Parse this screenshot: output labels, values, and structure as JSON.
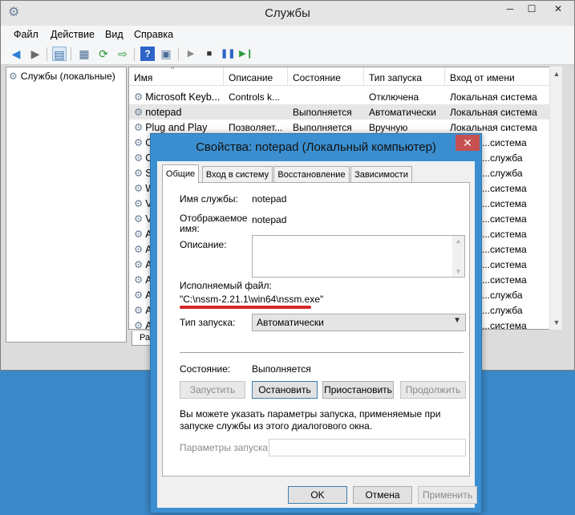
{
  "window": {
    "title": "Службы",
    "controls": {
      "minimize": "─",
      "maximize": "☐",
      "close": "✕"
    }
  },
  "menu": [
    "Файл",
    "Действие",
    "Вид",
    "Справка"
  ],
  "toolbar_icons": [
    "back-arrow-icon",
    "forward-arrow-icon",
    "console-tree-icon",
    "properties-icon",
    "refresh-icon",
    "export-icon",
    "help-icon",
    "view-icon",
    "play-icon",
    "stop-icon",
    "pause-icon",
    "restart-icon"
  ],
  "tree": {
    "root_label": "Службы (локальные)"
  },
  "list": {
    "columns": [
      "Имя",
      "Описание",
      "Состояние",
      "Тип запуска",
      "Вход от имени"
    ],
    "rows": [
      {
        "name": "Microsoft Keyb...",
        "description": "Controls k...",
        "state": "",
        "startup": "Отключена",
        "logon": "Локальная система"
      },
      {
        "name": "notepad",
        "description": "",
        "state": "Выполняется",
        "startup": "Автоматически",
        "logon": "Локальная система"
      },
      {
        "name": "Plug and Play",
        "description": "Позволяет...",
        "state": "Выполняется",
        "startup": "Вручную",
        "logon": "Локальная система"
      },
      {
        "name": "О",
        "logon": "...система"
      },
      {
        "name": "С",
        "logon": "...служба"
      },
      {
        "name": "S",
        "logon": "...служба"
      },
      {
        "name": "W",
        "logon": "...система"
      },
      {
        "name": "V",
        "logon": "...система"
      },
      {
        "name": "V",
        "logon": "...система"
      },
      {
        "name": "А",
        "logon": "...система"
      },
      {
        "name": "А",
        "logon": "...система"
      },
      {
        "name": "А",
        "logon": "...система"
      },
      {
        "name": "А",
        "logon": "...система"
      },
      {
        "name": "А",
        "logon": "...служба"
      },
      {
        "name": "А",
        "logon": "...служба"
      },
      {
        "name": "А",
        "logon": "...система"
      },
      {
        "name": "В",
        "logon": "...система"
      }
    ],
    "bottom_tab": "Рас"
  },
  "dialog": {
    "title": "Свойства: notepad (Локальный компьютер)",
    "close": "✕",
    "tabs": [
      "Общие",
      "Вход в систему",
      "Восстановление",
      "Зависимости"
    ],
    "service_name_label": "Имя службы:",
    "service_name": "notepad",
    "display_name_label": "Отображаемое имя:",
    "display_name": "notepad",
    "description_label": "Описание:",
    "description": "",
    "exe_label": "Исполняемый файл:",
    "exe_path": "\"C:\\nssm-2.21.1\\win64\\nssm.exe\"",
    "startup_label": "Тип запуска:",
    "startup_value": "Автоматически",
    "status_label": "Состояние:",
    "status_value": "Выполняется",
    "buttons": {
      "start": "Запустить",
      "stop": "Остановить",
      "pause": "Приостановить",
      "resume": "Продолжить"
    },
    "note": "Вы можете указать параметры запуска, применяемые при запуске службы из этого диалогового окна.",
    "params_label": "Параметры запуска:",
    "params_value": "",
    "footer": {
      "ok": "OK",
      "cancel": "Отмена",
      "apply": "Применить"
    }
  }
}
